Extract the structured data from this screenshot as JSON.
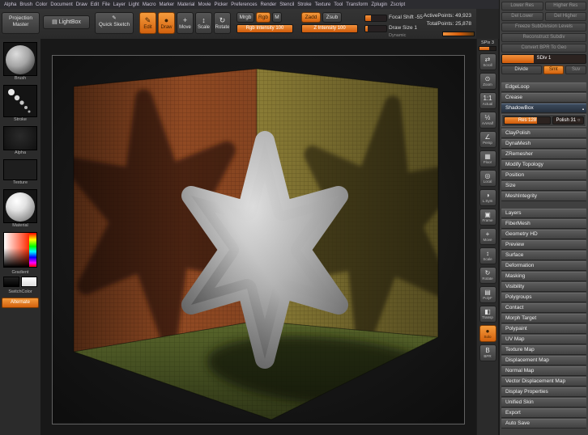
{
  "colors": {
    "accent_orange": "#e8690b",
    "selected_row_blue": "#2c3847",
    "left_wall": "#9c5026",
    "right_wall": "#9a8a3c",
    "floor": "#5d6b2d",
    "model_gray": "#b4b4b4",
    "canvas_background": "#101010",
    "panel_background": "#404040"
  },
  "menu_bar": {
    "items": [
      "Alpha",
      "Brush",
      "Color",
      "Document",
      "Draw",
      "Edit",
      "File",
      "Layer",
      "Light",
      "Macro",
      "Marker",
      "Material",
      "Movie",
      "Picker",
      "Preferences",
      "Render",
      "Stencil",
      "Stroke",
      "Texture",
      "Tool",
      "Transform",
      "Zplugin",
      "Zscript"
    ]
  },
  "top_shelf": {
    "projection_master_label": "Projection Master",
    "lightbox_label": "LightBox",
    "lightbox_icon": "▤",
    "quick_sketch_label": "Quick Sketch",
    "quick_sketch_icon": "✎",
    "edit_label": "Edit",
    "edit_icon": "✎",
    "draw_label": "Draw",
    "draw_icon": "●",
    "move_label": "Move",
    "move_icon": "+",
    "scale_label": "Scale",
    "scale_icon": "↕",
    "rotate_label": "Rotate",
    "rotate_icon": "↻",
    "mrgb_label": "Mrgb",
    "rgb_label": "Rgb",
    "m_label": "M",
    "rgb_intensity_label": "Rgb Intensity 100",
    "zadd_label": "Zadd",
    "zsub_label": "Zsub",
    "z_intensity_label": "Z Intensity 100",
    "focal_shift_label": "Focal Shift -55",
    "draw_size_label": "Draw Size 1",
    "dynamic_label": "Dynamic",
    "active_points": "ActivePoints: 49,923",
    "total_points": "TotalPoints: 25,878"
  },
  "left_shelf": {
    "brush_label": "Brush",
    "stroke_label": "Stroke",
    "alpha_label": "Alpha",
    "texture_label": "Texture",
    "material_label": "Material",
    "gradient_label": "Gradient",
    "switch_color_label": "SwitchColor",
    "alternate_label": "Alternate"
  },
  "right_shelf": {
    "spix_label": "SPix",
    "spix_value": "3",
    "icons": [
      {
        "label": "Scroll",
        "glyph": "⇄"
      },
      {
        "label": "Zoom",
        "glyph": "⊙"
      },
      {
        "label": "Actual",
        "glyph": "1:1"
      },
      {
        "label": "AAHalf",
        "glyph": "½"
      },
      {
        "label": "Persp",
        "glyph": "∠"
      },
      {
        "label": "Floor",
        "glyph": "▦"
      },
      {
        "label": "Local",
        "glyph": "◎"
      },
      {
        "label": "L.Sym",
        "glyph": "◑"
      },
      {
        "label": "Frame",
        "glyph": "▣"
      },
      {
        "label": "Move",
        "glyph": "+"
      },
      {
        "label": "Scale",
        "glyph": "↕"
      },
      {
        "label": "Rotate",
        "glyph": "↻"
      },
      {
        "label": "PolyF",
        "glyph": "▤"
      },
      {
        "label": "Transp",
        "glyph": "◧"
      },
      {
        "label": "Solo",
        "glyph": "●",
        "active": true
      },
      {
        "label": "BPR",
        "glyph": "B"
      }
    ]
  },
  "tool_panel": {
    "geometry": {
      "lower_res_label": "Lower Res",
      "higher_res_label": "Higher Res",
      "del_lower_label": "Del Lower",
      "del_higher_label": "Del Higher",
      "freeze_label": "Freeze SubDivision Levels",
      "reconstruct_label": "Reconstruct Subdiv",
      "convert_bpr_label": "Convert BPR To Geo",
      "sdiv_label": "SDiv 1",
      "divide_label": "Divide",
      "smt_label": "Smt",
      "suv_label": "Suv",
      "edgeloop_label": "EdgeLoop",
      "crease_label": "Crease",
      "shadowbox_label": "ShadowBox",
      "res_label": "Res 128",
      "polish_label": "Polish 31",
      "polish_toggle_icon": "○",
      "shadowbox_marker_icon": "▪",
      "sections": [
        "ClayPolish",
        "DynaMesh",
        "ZRemesher",
        "Modify Topology",
        "Position",
        "Size",
        "MeshIntegrity"
      ]
    },
    "subpalettes": [
      "Layers",
      "FiberMesh",
      "Geometry HD",
      "Preview",
      "Surface",
      "Deformation",
      "Masking",
      "Visibility",
      "Polygroups",
      "Contact",
      "Morph Target",
      "Polypaint",
      "UV Map",
      "Texture Map",
      "Displacement Map",
      "Normal Map",
      "Vector Displacement Map",
      "Display Properties",
      "Unified Skin",
      "Export",
      "Auto Save"
    ]
  },
  "viewport": {
    "model_name": "star-primitive",
    "scene_name": "shadowbox"
  }
}
